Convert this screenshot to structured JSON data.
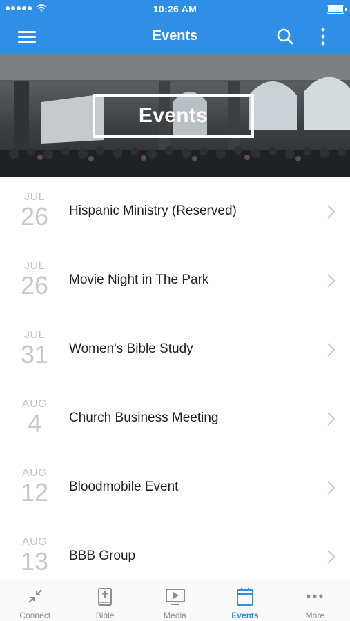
{
  "status_bar": {
    "time": "10:26 AM"
  },
  "nav": {
    "title": "Events",
    "icons": [
      "menu-icon",
      "search-icon",
      "more-vertical-icon"
    ]
  },
  "hero": {
    "title": "Events"
  },
  "events": [
    {
      "month": "JUL",
      "day": "26",
      "title": "Hispanic Ministry (Reserved)"
    },
    {
      "month": "JUL",
      "day": "26",
      "title": "Movie Night in The Park"
    },
    {
      "month": "JUL",
      "day": "31",
      "title": "Women's Bible Study"
    },
    {
      "month": "AUG",
      "day": "4",
      "title": "Church Business Meeting"
    },
    {
      "month": "AUG",
      "day": "12",
      "title": "Bloodmobile Event"
    },
    {
      "month": "AUG",
      "day": "13",
      "title": "BBB Group"
    }
  ],
  "tabs": [
    {
      "label": "Connect",
      "icon": "connect-icon"
    },
    {
      "label": "Bible",
      "icon": "bible-icon"
    },
    {
      "label": "Media",
      "icon": "media-icon"
    },
    {
      "label": "Events",
      "icon": "calendar-icon",
      "active": true
    },
    {
      "label": "More",
      "icon": "more-horizontal-icon"
    }
  ],
  "colors": {
    "accent": "#2f8ee5",
    "date_text": "#c4c4c4",
    "title_text": "#222222",
    "tab_inactive": "#8e8e8e"
  }
}
